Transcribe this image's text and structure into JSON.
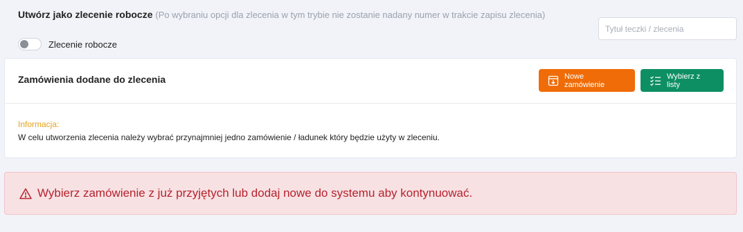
{
  "draft": {
    "title": "Utwórz jako zlecenie robocze",
    "hint": "(Po wybraniu opcji dla zlecenia w tym trybie nie zostanie nadany numer w trakcie zapisu zlecenia)",
    "toggle_label": "Zlecenie robocze",
    "toggle_on": false
  },
  "title_input": {
    "placeholder": "Tytuł teczki / zlecenia",
    "value": ""
  },
  "orders_card": {
    "title": "Zamówienia dodane do zlecenia",
    "new_order_label": "Nowe zamówienie",
    "pick_list_label": "Wybierz z listy",
    "info_label": "Informacja:",
    "info_text": "W celu utworzenia zlecenia należy wybrać przynajmniej jedno zamówienie / ładunek który będzie użyty w zleceniu."
  },
  "alert": {
    "text": "Wybierz zamówienie z już przyjętych lub dodaj nowe do systemu aby kontynuować.",
    "icon": "warning-triangle-icon"
  },
  "colors": {
    "orange": "#ef6c08",
    "green": "#0e8f63",
    "info": "#e3a21a",
    "danger_text": "#b4232e",
    "danger_bg": "#f8e1e3"
  }
}
